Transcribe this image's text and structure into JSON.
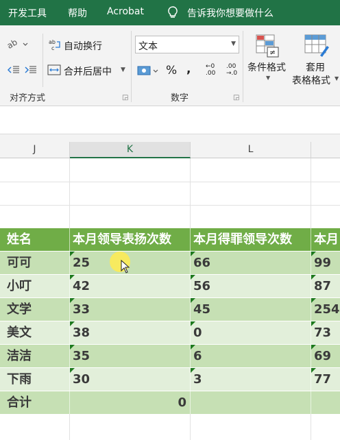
{
  "tabs": {
    "developer": "开发工具",
    "help": "帮助",
    "acrobat": "Acrobat",
    "tell_me": "告诉我你想要做什么"
  },
  "ribbon": {
    "wrap_text": "自动换行",
    "merge_center": "合并后居中",
    "alignment_group": "对齐方式",
    "number_format": "文本",
    "percent": "%",
    "comma": ",",
    "increase_decimal_top": "←0",
    "increase_decimal_bottom": ".00",
    "decrease_decimal_top": ".00",
    "decrease_decimal_bottom": "→.0",
    "number_group": "数字",
    "conditional_format": "条件格式",
    "format_table_1": "套用",
    "format_table_2": "表格格式"
  },
  "columns": [
    "J",
    "K",
    "L"
  ],
  "table": {
    "headers": [
      "姓名",
      "本月领导表扬次数",
      "本月得罪领导次数",
      "本月"
    ],
    "rows": [
      {
        "name": "可可",
        "k": "25",
        "l": "66",
        "m": "99"
      },
      {
        "name": "小叮",
        "k": "42",
        "l": "56",
        "m": "87"
      },
      {
        "name": "文学",
        "k": "33",
        "l": "45",
        "m": "254"
      },
      {
        "name": "美文",
        "k": "38",
        "l": "0",
        "m": "73"
      },
      {
        "name": "洁洁",
        "k": "35",
        "l": "6",
        "m": "69"
      },
      {
        "name": "下雨",
        "k": "30",
        "l": "3",
        "m": "77"
      }
    ],
    "total_label": "合计",
    "total_value": "0"
  },
  "colors": {
    "ribbon_green": "#217346",
    "header_green": "#70ad47",
    "band_dark": "#c6e0b4",
    "band_light": "#e2efda"
  }
}
